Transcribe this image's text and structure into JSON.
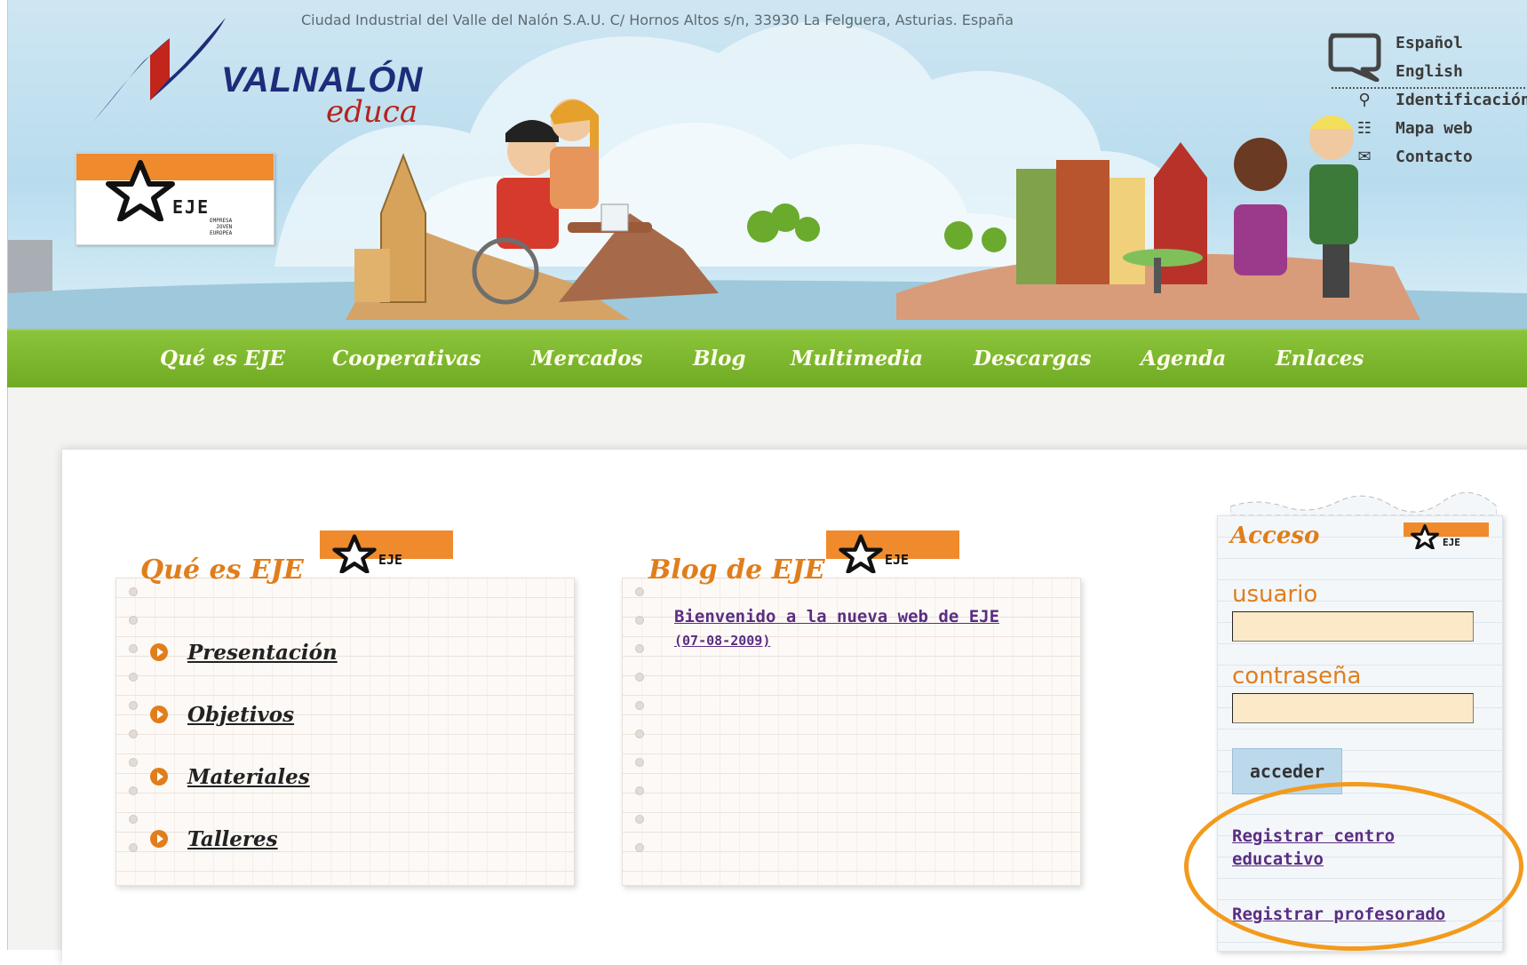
{
  "header": {
    "address": "Ciudad Industrial del Valle del Nalón S.A.U. C/ Hornos Altos s/n, 33930 La Felguera, Asturias. España",
    "logo_main": "VALNALÓN",
    "logo_sub": "educa",
    "eje_logo_text": "EJE",
    "eje_logo_sub": "EMPRESA\nJOVEN\nEUROPEA"
  },
  "top_links": {
    "languages": [
      "Español",
      "English"
    ],
    "utilities": [
      {
        "label": "Identificación",
        "icon": "person-icon"
      },
      {
        "label": "Mapa web",
        "icon": "sitemap-icon"
      },
      {
        "label": "Contacto",
        "icon": "envelope-icon"
      }
    ],
    "bubble_icon": "speech-bubble-icon"
  },
  "nav": {
    "items": [
      "Qué es EJE",
      "Cooperativas",
      "Mercados",
      "Blog",
      "Multimedia",
      "Descargas",
      "Agenda",
      "Enlaces"
    ]
  },
  "que_es": {
    "title": "Qué es EJE",
    "items": [
      "Presentación",
      "Objetivos",
      "Materiales",
      "Talleres"
    ]
  },
  "blog": {
    "title": "Blog de EJE",
    "post_title": "Bienvenido a la nueva web de EJE",
    "post_date": "(07-08-2009)"
  },
  "access": {
    "title": "Acceso",
    "user_label": "usuario",
    "password_label": "contraseña",
    "user_value": "",
    "password_value": "",
    "submit_label": "acceder",
    "register_center_line1": "Registrar centro",
    "register_center_line2": "educativo",
    "register_teacher": "Registrar profesorado"
  },
  "colors": {
    "accent_orange": "#e07e1c",
    "nav_green": "#7bb52d",
    "link_purple": "#5a2d82",
    "highlight_ring": "#f39a1c"
  }
}
